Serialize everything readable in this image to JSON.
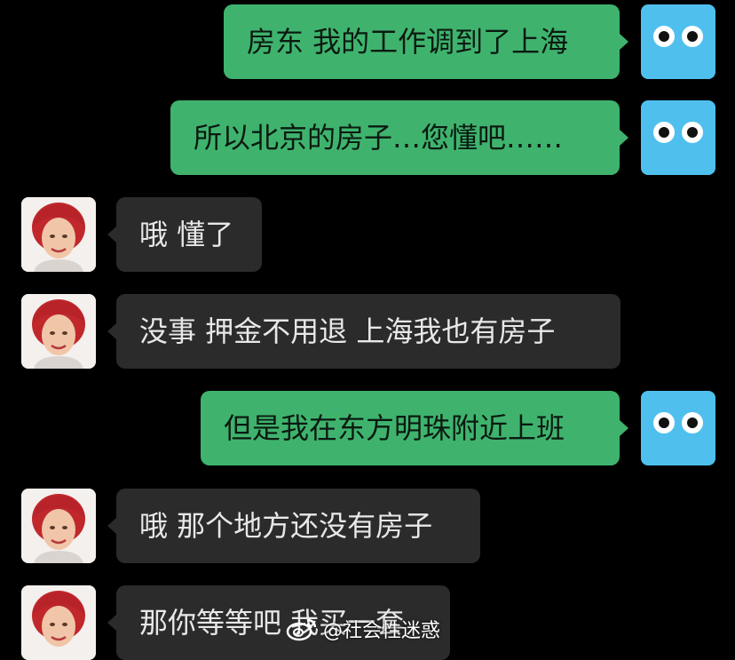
{
  "messages": [
    {
      "side": "me",
      "text": "房东 我的工作调到了上海"
    },
    {
      "side": "me",
      "text": "所以北京的房子…您懂吧……"
    },
    {
      "side": "them",
      "text": "哦 懂了"
    },
    {
      "side": "them",
      "text": "没事 押金不用退 上海我也有房子"
    },
    {
      "side": "me",
      "text": "但是我在东方明珠附近上班"
    },
    {
      "side": "them",
      "text": "哦 那个地方还没有房子"
    },
    {
      "side": "them",
      "text": "那你等等吧 我买一套"
    }
  ],
  "watermark": {
    "text": "@社会性迷惑",
    "icon": "weibo-logo"
  },
  "colors": {
    "background": "#000000",
    "my_bubble": "#3fb36e",
    "their_bubble": "#2b2b2b",
    "my_avatar": "#4fc0ee"
  }
}
